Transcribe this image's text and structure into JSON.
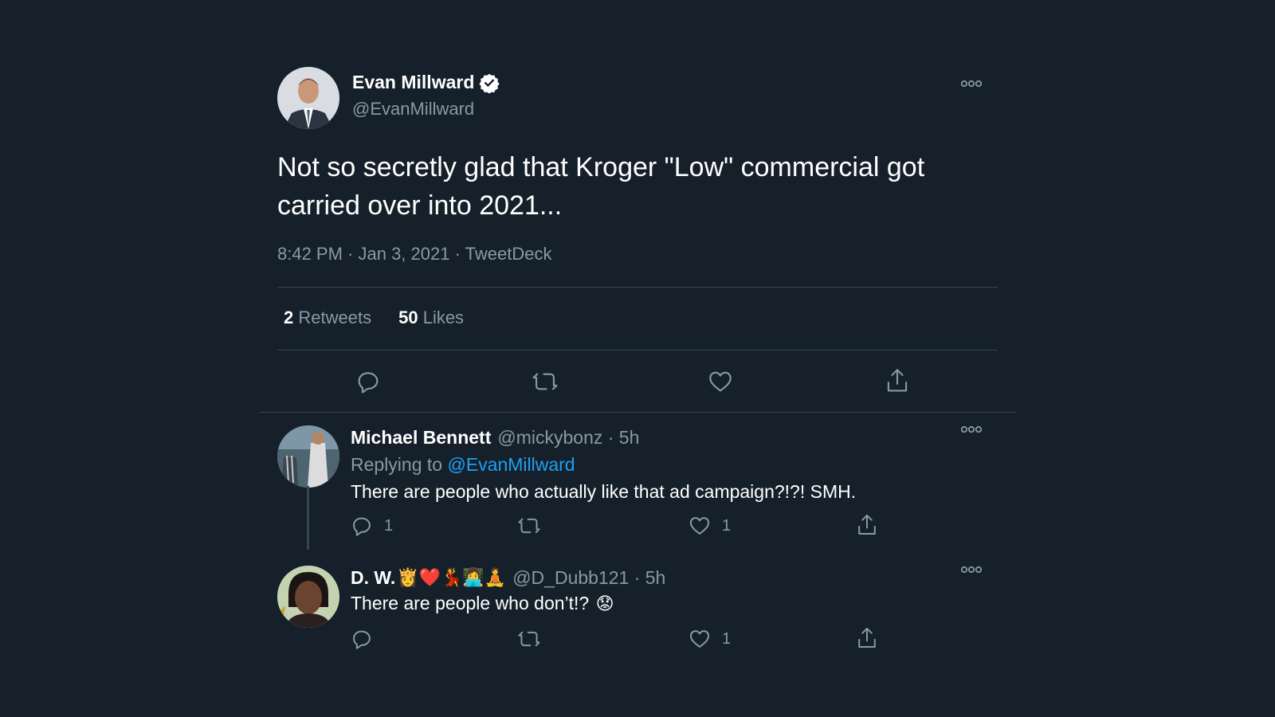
{
  "main_tweet": {
    "author_name": "Evan Millward",
    "handle": "@EvanMillward",
    "text": "Not so secretly glad that Kroger \"Low\" commercial got carried over into 2021...",
    "meta": "8:42 PM · Jan 3, 2021 · TweetDeck",
    "retweets_count": "2",
    "retweets_label": "Retweets",
    "likes_count": "50",
    "likes_label": "Likes"
  },
  "replies": [
    {
      "author_name": "Michael Bennett",
      "handle_time": "@mickybonz · 5h",
      "replying_prefix": "Replying to",
      "replying_handle": "@EvanMillward",
      "text": "There are people who actually like that ad campaign?!?!  SMH.",
      "reply_count": "1",
      "like_count": "1"
    },
    {
      "author_name": "D. W.",
      "name_emojis": "👸❤️💃👩‍💻🧘",
      "handle_time": "@D_Dubb121 · 5h",
      "text": "There are people who don’t!?",
      "text_emoji": "😟",
      "like_count": "1"
    }
  ],
  "icons": [
    "verified-icon",
    "more-icon",
    "reply-icon",
    "retweet-icon",
    "like-icon",
    "share-icon"
  ],
  "colors": {
    "background": "#15202b",
    "secondary_text": "#8899a6",
    "link": "#1da1f2",
    "divider": "#38444d"
  }
}
